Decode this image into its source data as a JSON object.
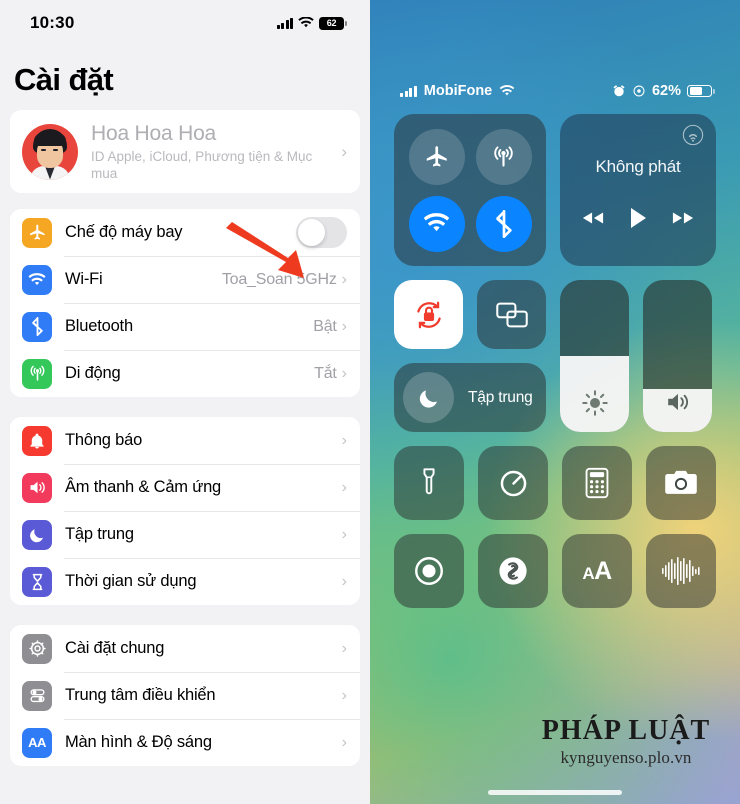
{
  "settings": {
    "status_bar": {
      "time": "10:30",
      "battery_percent": "62",
      "signal_icon": "cellular-bars-icon",
      "wifi_icon": "wifi-icon"
    },
    "title": "Cài đặt",
    "profile": {
      "name": "Hoa Hoa Hoa",
      "subtitle": "ID Apple, iCloud, Phương tiện & Mục mua",
      "chevron": "›"
    },
    "group1": [
      {
        "label": "Chế độ máy bay",
        "icon": "airplane-icon",
        "color": "#f5a623",
        "control": "toggle",
        "toggle_on": false
      },
      {
        "label": "Wi-Fi",
        "icon": "wifi-icon",
        "color": "#2f7cf6",
        "value": "Toa_Soan 5GHz",
        "chevron": "›"
      },
      {
        "label": "Bluetooth",
        "icon": "bluetooth-icon",
        "color": "#2f7cf6",
        "value": "Bật",
        "chevron": "›"
      },
      {
        "label": "Di động",
        "icon": "cellular-antenna-icon",
        "color": "#34c759",
        "value": "Tắt",
        "chevron": "›"
      }
    ],
    "group2": [
      {
        "label": "Thông báo",
        "icon": "bell-icon",
        "color": "#f63a2f",
        "chevron": "›"
      },
      {
        "label": "Âm thanh & Cảm ứng",
        "icon": "speaker-icon",
        "color": "#f23a5c",
        "chevron": "›"
      },
      {
        "label": "Tập trung",
        "icon": "moon-icon",
        "color": "#5a5ad6",
        "chevron": "›"
      },
      {
        "label": "Thời gian sử dụng",
        "icon": "hourglass-icon",
        "color": "#5a5ad6",
        "chevron": "›"
      }
    ],
    "group3": [
      {
        "label": "Cài đặt chung",
        "icon": "gear-icon",
        "color": "#8e8e93",
        "chevron": "›"
      },
      {
        "label": "Trung tâm điều khiển",
        "icon": "control-toggles-icon",
        "color": "#8e8e93",
        "chevron": "›"
      },
      {
        "label": "Màn hình & Độ sáng",
        "icon": "text-size-icon",
        "color": "#2f7cf6",
        "chevron": "›"
      }
    ]
  },
  "control_center": {
    "status_bar": {
      "carrier": "MobiFone",
      "signal_icon": "cellular-bars-icon",
      "wifi_icon": "wifi-icon",
      "alarm_icon": "alarm-clock-icon",
      "rotation_lock_icon": "rotation-lock-icon",
      "battery_text": "62%"
    },
    "connectivity": [
      {
        "name": "airplane-mode-button",
        "icon": "airplane-icon",
        "state": "off"
      },
      {
        "name": "cellular-data-button",
        "icon": "cellular-antenna-icon",
        "state": "off"
      },
      {
        "name": "wifi-button",
        "icon": "wifi-icon",
        "state": "on"
      },
      {
        "name": "bluetooth-button",
        "icon": "bluetooth-icon",
        "state": "on"
      }
    ],
    "media": {
      "title": "Không phát",
      "airplay_icon": "airplay-icon",
      "prev_icon": "rewind-icon",
      "play_icon": "play-icon",
      "next_icon": "fast-forward-icon"
    },
    "rotation_lock": {
      "label_icon": "rotation-lock-icon",
      "active": true
    },
    "screen_mirroring": {
      "label_icon": "screen-mirroring-icon"
    },
    "focus": {
      "label": "Tập trung",
      "icon": "moon-icon"
    },
    "brightness": {
      "icon": "brightness-icon",
      "level_percent": 50
    },
    "volume": {
      "icon": "volume-icon",
      "level_percent": 28
    },
    "tiles": [
      {
        "name": "flashlight-button",
        "icon": "flashlight-icon"
      },
      {
        "name": "timer-button",
        "icon": "timer-icon"
      },
      {
        "name": "calculator-button",
        "icon": "calculator-icon"
      },
      {
        "name": "camera-button",
        "icon": "camera-icon"
      },
      {
        "name": "screen-record-button",
        "icon": "record-icon"
      },
      {
        "name": "shazam-button",
        "icon": "shazam-icon"
      },
      {
        "name": "text-size-button",
        "icon": "text-size-icon"
      },
      {
        "name": "voice-memo-button",
        "icon": "sound-wave-icon"
      }
    ],
    "watermark": {
      "logo": "PHÁP LUẬT",
      "url": "kynguyenso.plo.vn"
    }
  },
  "annotations": {
    "arrow_color": "#ee3b1f",
    "arrow_left_target": "airplane-mode-toggle",
    "arrow_right_target": "airplane-mode-button"
  }
}
